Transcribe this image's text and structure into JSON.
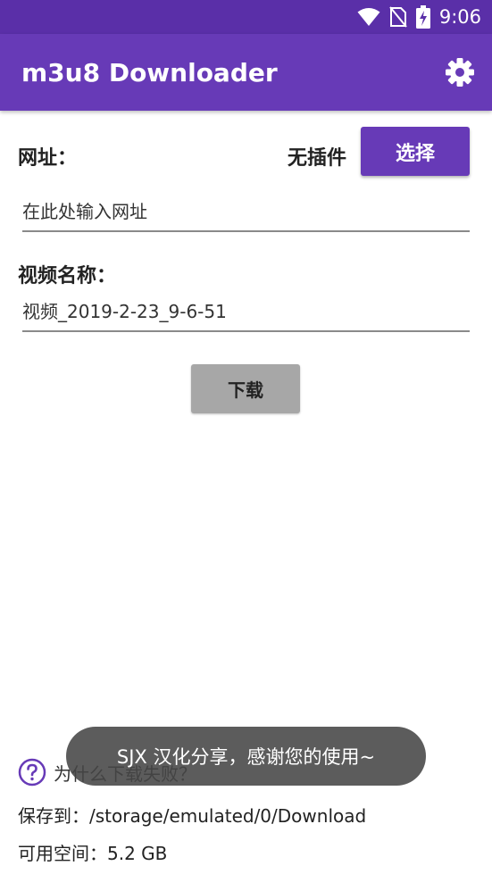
{
  "status_bar": {
    "time": "9:06",
    "icons": [
      "wifi-icon",
      "no-sim-icon",
      "battery-charging-icon"
    ],
    "color": "#5a2fa8"
  },
  "app_bar": {
    "title": "m3u8 Downloader",
    "color": "#673ab7",
    "settings_icon": "gear-icon"
  },
  "form": {
    "url_label": "网址：",
    "plugin_status": "无插件",
    "select_button": "选择",
    "url_input_placeholder": "在此处输入网址",
    "name_label": "视频名称：",
    "name_input_value": "视频_2019-2-23_9-6-51",
    "download_button": "下载"
  },
  "footer": {
    "help_icon": "question-circle-icon",
    "help_text": "为什么下载失败？",
    "save_path": "保存到：/storage/emulated/0/Download",
    "free_space": "可用空间：5.2 GB"
  },
  "toast": {
    "message": "SJX 汉化分享，感谢您的使用~"
  }
}
